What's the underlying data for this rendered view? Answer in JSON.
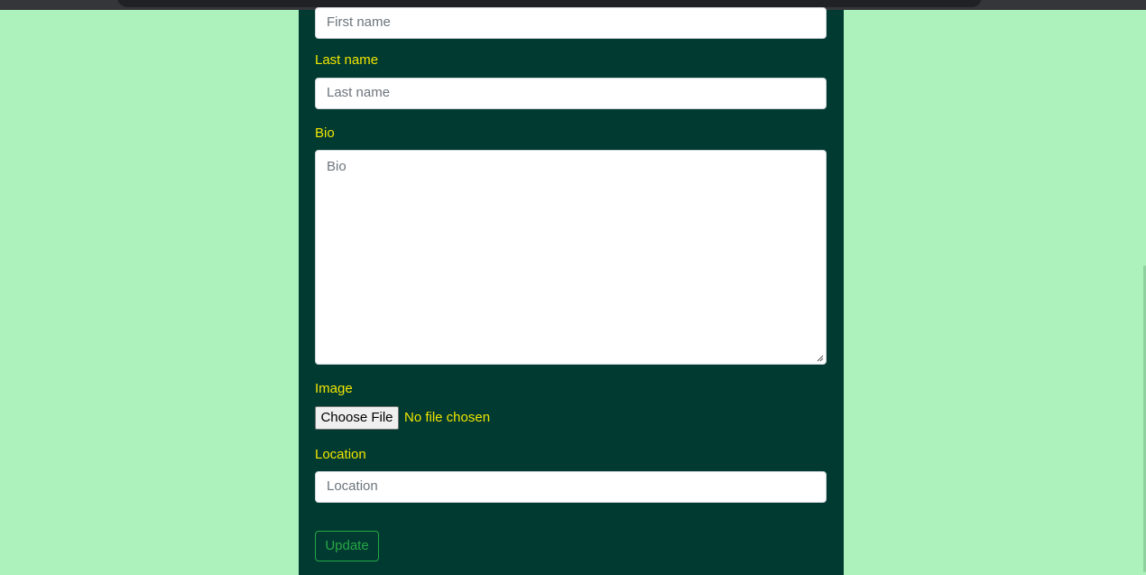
{
  "colors": {
    "page_background": "#adf1bc",
    "panel_background": "#003a31",
    "label_text": "#f2e600",
    "update_button": "#28a745"
  },
  "form": {
    "first_name": {
      "placeholder": "First name",
      "value": ""
    },
    "last_name": {
      "label": "Last name",
      "placeholder": "Last name",
      "value": ""
    },
    "bio": {
      "label": "Bio",
      "placeholder": "Bio",
      "value": ""
    },
    "image": {
      "label": "Image",
      "button_label": "Choose File",
      "status": "No file chosen"
    },
    "location": {
      "label": "Location",
      "placeholder": "Location",
      "value": ""
    },
    "submit_label": "Update"
  }
}
